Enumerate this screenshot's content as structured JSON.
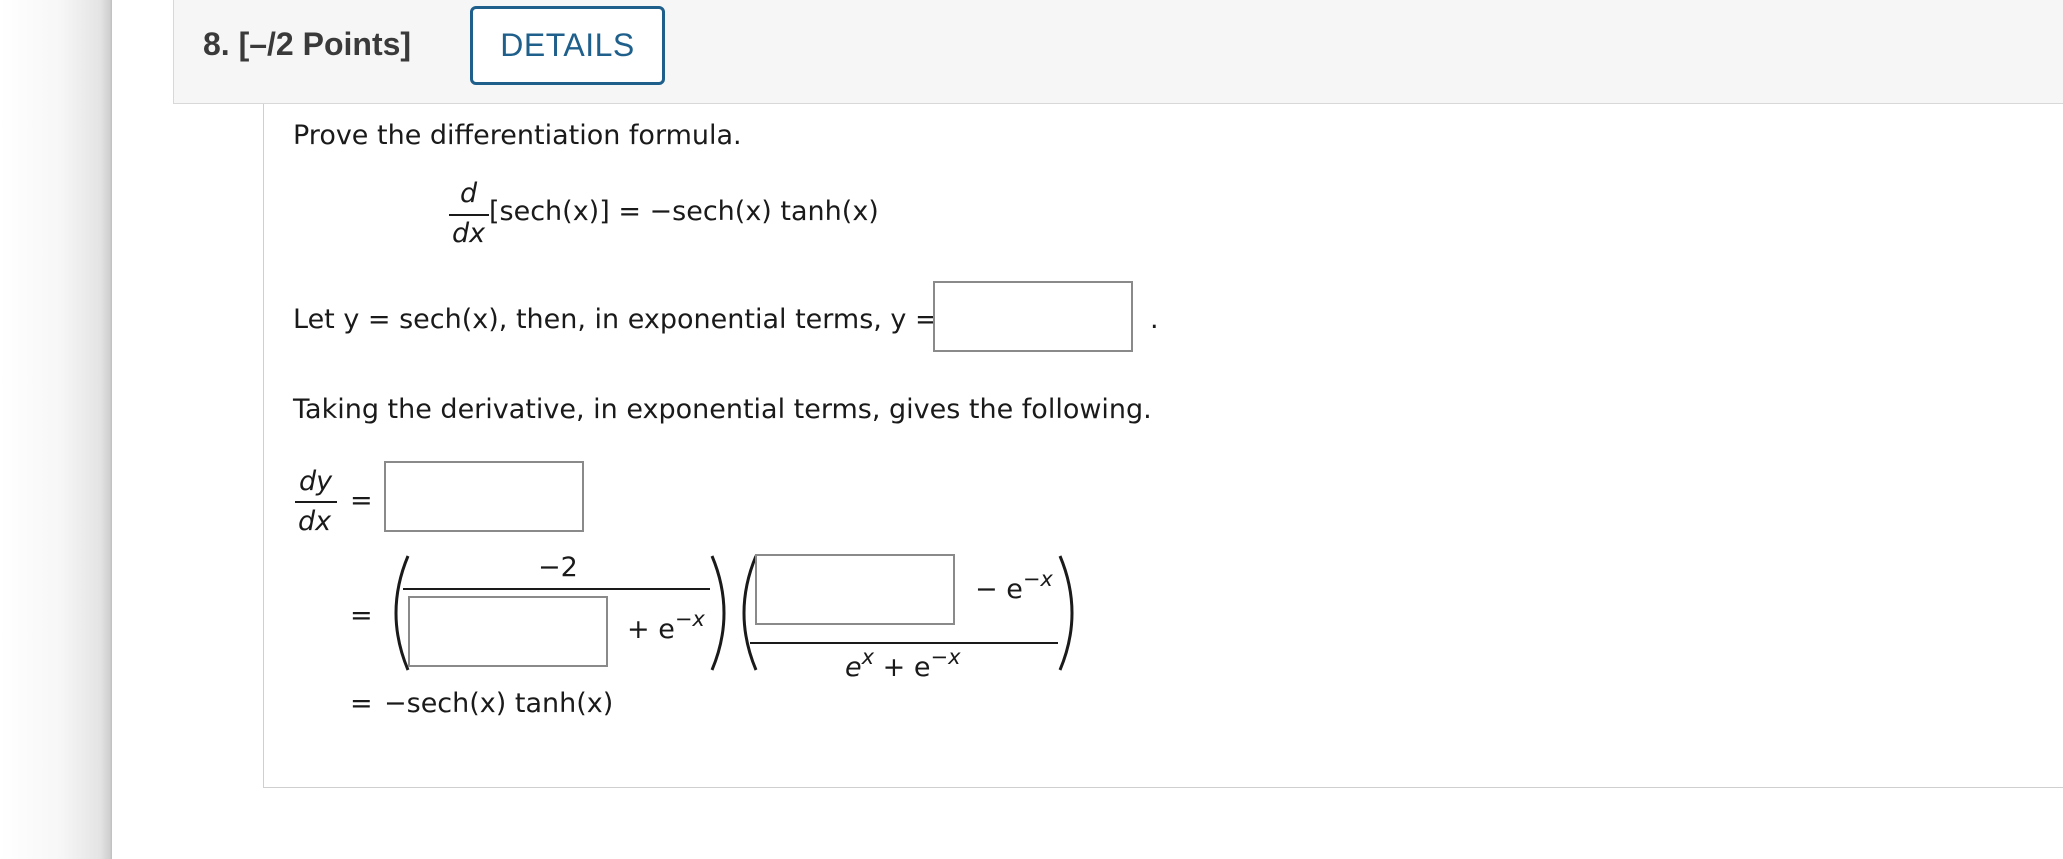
{
  "header": {
    "question_label": "8.  [–/2 Points]",
    "details_label": "DETAILS"
  },
  "problem": {
    "instruction": "Prove the differentiation formula.",
    "formula": {
      "d": "d",
      "dx": "dx",
      "lhs_rest": "[sech(x)] = −sech(x) tanh(x)"
    },
    "let_line": {
      "prefix": "Let y = sech(x), then, in exponential terms, y =",
      "answer_value": "",
      "period": "."
    },
    "derivative_intro": "Taking the derivative, in exponential terms, gives the following.",
    "step1": {
      "dy": "dy",
      "dx": "dx",
      "equals": "=",
      "answer_value": ""
    },
    "step2": {
      "equals": "=",
      "numerator": "−2",
      "denominator_plus": "+ e",
      "denominator_sup": "−x",
      "denominator_answer": "",
      "second_numerator_minus": "− e",
      "second_numerator_sup": "−x",
      "second_numerator_answer": "",
      "second_denominator": "e",
      "second_denominator_sup1": "x",
      "second_denominator_mid": " + e",
      "second_denominator_sup2": "−x"
    },
    "step3": {
      "equals": "=",
      "result": "−sech(x) tanh(x)"
    }
  },
  "colors": {
    "details_accent": "#1f5f8b",
    "header_bg": "#f6f6f6"
  }
}
